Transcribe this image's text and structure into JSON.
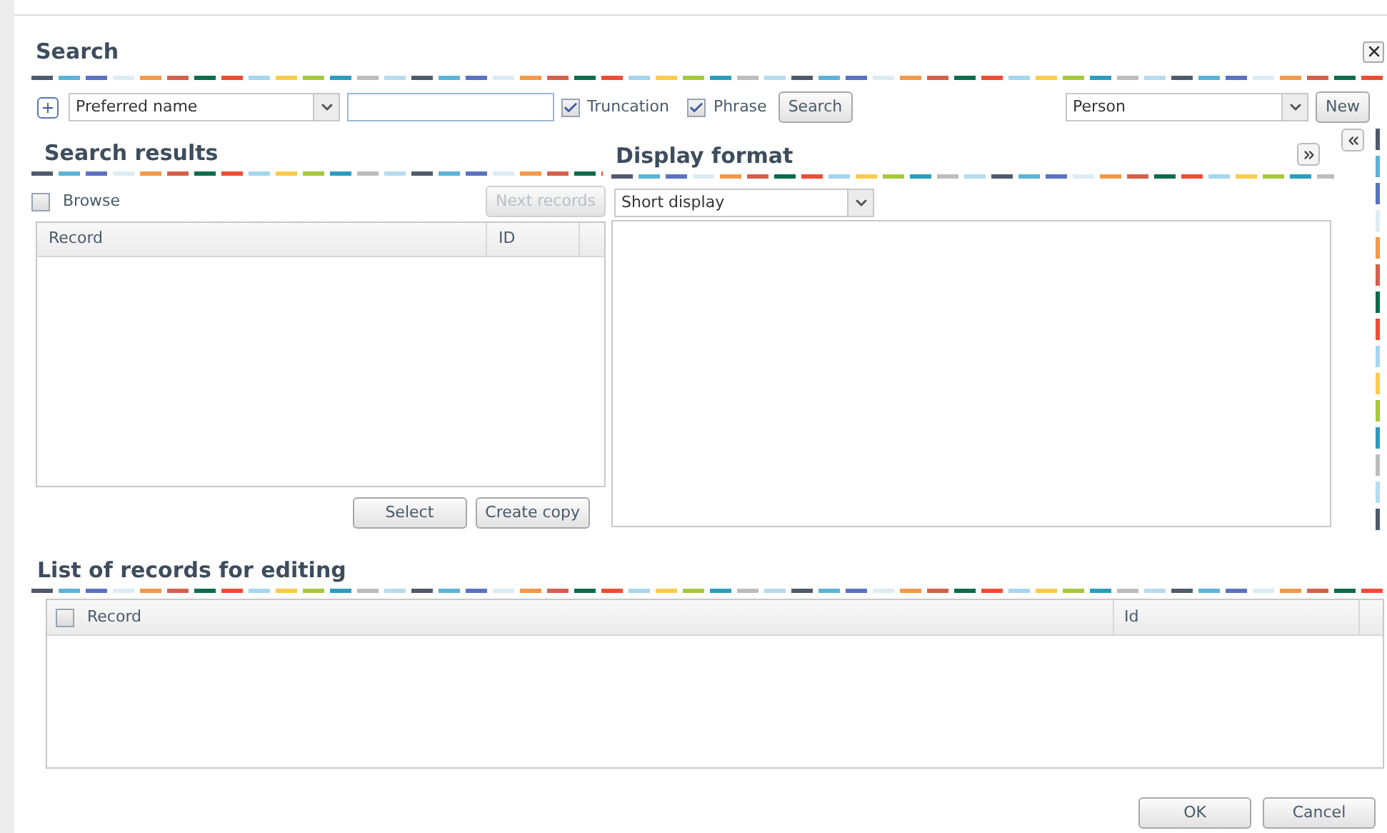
{
  "dialog": {
    "title": "Search"
  },
  "search_bar": {
    "criteria": {
      "value": "Preferred name"
    },
    "options": [
      {
        "label": "Truncation",
        "checked": true
      },
      {
        "label": "Phrase",
        "checked": true
      }
    ],
    "search_button": "Search",
    "record_type": {
      "value": "Person"
    },
    "new_button": "New"
  },
  "search_results": {
    "title": "Search results",
    "browse": {
      "label": "Browse",
      "checked": false
    },
    "next_button": {
      "label": "Next records",
      "disabled": true
    },
    "columns": [
      "Record",
      "ID"
    ],
    "buttons": [
      "Select",
      "Create copy"
    ]
  },
  "display_format": {
    "title": "Display format",
    "format": {
      "value": "Short display"
    }
  },
  "editing_list": {
    "title": "List of records for editing",
    "select_all": {
      "checked": false
    },
    "columns": [
      "Record",
      "Id"
    ]
  },
  "buttons": [
    "OK",
    "Cancel"
  ]
}
